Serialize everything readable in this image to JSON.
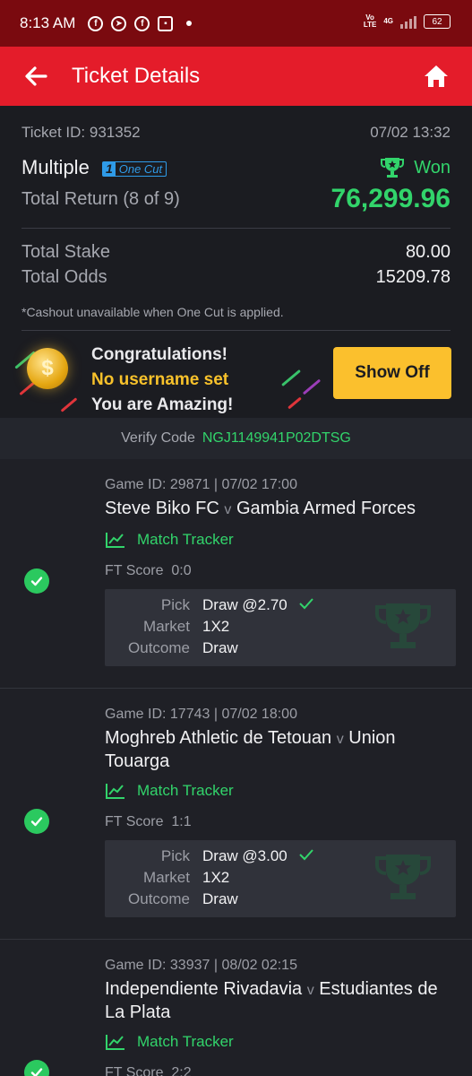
{
  "status_bar": {
    "time": "8:13 AM",
    "network": "4G",
    "volte_top": "Vo",
    "volte_bottom": "LTE",
    "battery": "62"
  },
  "app_bar": {
    "title": "Ticket Details",
    "back_icon": "arrow-left-icon",
    "home_icon": "home-icon"
  },
  "ticket": {
    "id_label": "Ticket ID: 931352",
    "datetime": "07/02 13:32",
    "type": "Multiple",
    "one_cut_number": "1",
    "one_cut_label": "One Cut",
    "status": "Won",
    "total_return_label": "Total Return (8 of 9)",
    "total_return": "76,299.96",
    "total_stake_label": "Total Stake",
    "total_stake": "80.00",
    "total_odds_label": "Total Odds",
    "total_odds": "15209.78",
    "cashout_note": "*Cashout unavailable when One Cut is applied."
  },
  "congrats": {
    "line1": "Congratulations!",
    "line2": "No username set",
    "line3": "You are Amazing!",
    "button": "Show Off"
  },
  "verify": {
    "label": "Verify Code",
    "code": "NGJ1149941P02DTSG"
  },
  "games": [
    {
      "header": "Game ID: 29871 | 07/02 17:00",
      "home": "Steve Biko FC",
      "vs": "v",
      "away": "Gambia Armed Forces",
      "tracker": "Match Tracker",
      "ft_label": "FT Score",
      "ft_score": "0:0",
      "pick_label": "Pick",
      "pick": "Draw @2.70",
      "market_label": "Market",
      "market": "1X2",
      "outcome_label": "Outcome",
      "outcome": "Draw"
    },
    {
      "header": "Game ID: 17743 | 07/02 18:00",
      "home": "Moghreb Athletic de Tetouan",
      "vs": "v",
      "away": "Union Touarga",
      "tracker": "Match Tracker",
      "ft_label": "FT Score",
      "ft_score": "1:1",
      "pick_label": "Pick",
      "pick": "Draw @3.00",
      "market_label": "Market",
      "market": "1X2",
      "outcome_label": "Outcome",
      "outcome": "Draw"
    },
    {
      "header": "Game ID: 33937 | 08/02 02:15",
      "home": "Independiente Rivadavia",
      "vs": "v",
      "away": "Estudiantes de La Plata",
      "tracker": "Match Tracker",
      "ft_label": "FT Score",
      "ft_score": "2:2"
    }
  ],
  "colors": {
    "brand_red": "#e41c2a",
    "status_red": "#7a0a0f",
    "win_green": "#32d46b",
    "accent_yellow": "#fbc02d",
    "one_cut_blue": "#2f9be8"
  }
}
